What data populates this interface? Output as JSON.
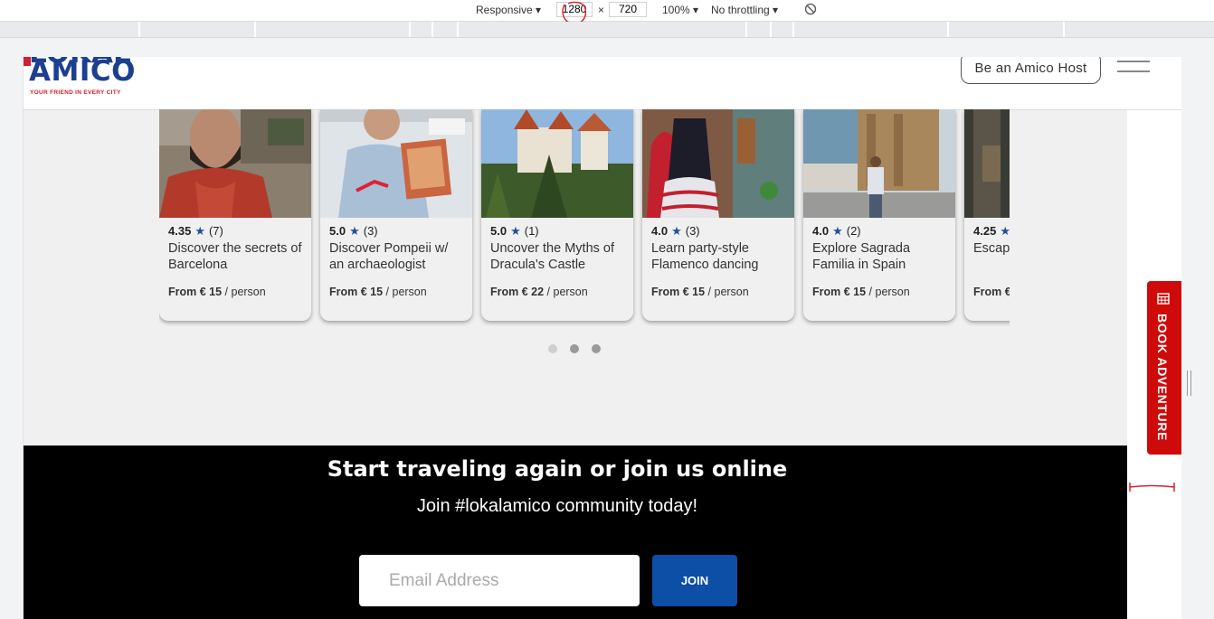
{
  "devtools": {
    "device_mode": "Responsive",
    "width": "1280",
    "times": "×",
    "height": "720",
    "zoom": "100%",
    "throttling": "No throttling"
  },
  "header": {
    "logo_top": "LOKAL",
    "logo_word": "AMICO",
    "logo_tagline": "YOUR FRIEND IN EVERY CITY",
    "host_button": "Be an Amico Host"
  },
  "cards": [
    {
      "rating": "4.35",
      "reviews": "(7)",
      "title": "Discover the secrets of Barcelona",
      "price_prefix": "From € 15",
      "price_suffix": "/ person"
    },
    {
      "rating": "5.0",
      "reviews": "(3)",
      "title": "Discover Pompeii w/ an archaeologist",
      "price_prefix": "From € 15",
      "price_suffix": "/ person"
    },
    {
      "rating": "5.0",
      "reviews": "(1)",
      "title": "Uncover the Myths of Dracula's Castle",
      "price_prefix": "From € 22",
      "price_suffix": "/ person"
    },
    {
      "rating": "4.0",
      "reviews": "(3)",
      "title": "Learn party-style Flamenco dancing",
      "price_prefix": "From € 15",
      "price_suffix": "/ person"
    },
    {
      "rating": "4.0",
      "reviews": "(2)",
      "title": "Explore Sagrada Familia in Spain",
      "price_prefix": "From € 15",
      "price_suffix": "/ person"
    },
    {
      "rating": "4.25",
      "reviews": "",
      "title": "Escape Ubud,",
      "price_prefix": "From €",
      "price_suffix": ""
    }
  ],
  "star": "★",
  "book_adventure": "BOOK ADVENTURE",
  "cta": {
    "title": "Start traveling again or join us online",
    "subtitle": "Join #lokalamico community today!",
    "email_placeholder": "Email Address",
    "join_label": "JOIN"
  },
  "colors": {
    "brand_blue": "#1c3f8f",
    "brand_red": "#d11f2f",
    "join_blue": "#0d4ea6",
    "book_red": "#cf0a0a"
  }
}
